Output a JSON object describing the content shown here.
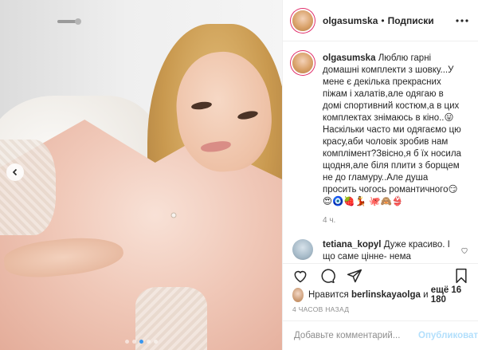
{
  "post": {
    "photo": {
      "carousel_dots": 5,
      "active_dot_index": 2
    },
    "header": {
      "username": "olgasumska",
      "separator": "•",
      "follow_status": "Подписки"
    },
    "caption": {
      "username": "olgasumska",
      "text": "Люблю гарні домашні комплекти з шовку...У мене є декілька прекрасних піжам і халатів,але одягаю в домі спортивний костюм,а в цих комплектах знімаюсь в кіно..😛 Наскільки часто ми одягаємо цю красу,аби чоловік зробив нам комплімент?Звісно,я б їх носила щодня,але біля плити з борщем не до гламуру..Але душа просить чогось романтичного😏😍🧿🍓💃 🐙🙈👙",
      "time": "4 ч."
    },
    "comments": [
      {
        "username": "tetiana_kopyl",
        "text": "Дуже красиво. І що саме цінне- нема реклами. Просто фото в фантастично красивому комплекті❤️"
      }
    ],
    "likes": {
      "prefix": "Нравится",
      "liker": "berlinskayaolga",
      "middle": "и",
      "count_text": "ещё 16 180"
    },
    "timestamp": "4 ЧАСОВ НАЗАД",
    "add_comment": {
      "placeholder": "Добавьте комментарий...",
      "publish_label": "Опубликовать"
    }
  },
  "icons": {
    "more": "more-icon",
    "like": "heart-icon",
    "comment": "comment-icon",
    "share": "share-icon",
    "save": "bookmark-icon",
    "emoji": "emoji-icon",
    "carousel_prev": "chevron-left-icon"
  },
  "colors": {
    "text": "#262626",
    "muted": "#8e8e8e",
    "publish_disabled": "#b2dffc",
    "active_dot": "#3897f0"
  }
}
